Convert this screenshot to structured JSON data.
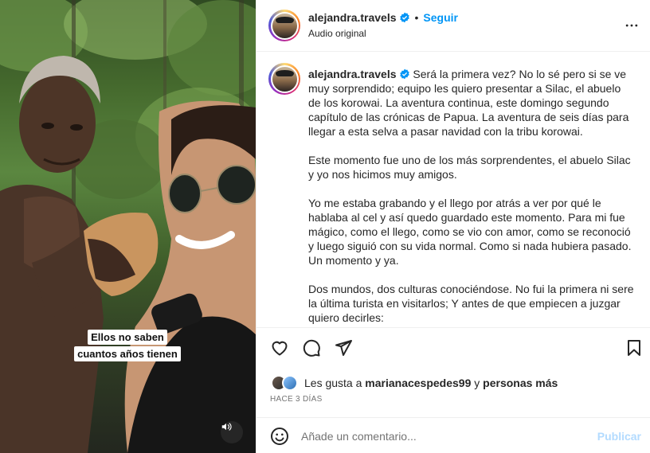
{
  "video": {
    "caption_line1": "Ellos no saben",
    "caption_line2": "cuantos años tienen",
    "mute_icon": "speaker-icon"
  },
  "header": {
    "username": "alejandra.travels",
    "separator": "•",
    "follow_label": "Seguir",
    "audio_label": "Audio original",
    "more_icon": "more-horizontal-icon"
  },
  "post": {
    "username": "alejandra.travels",
    "paragraphs": [
      "Será la primera vez? No lo sé pero si se ve muy sorprendido; equipo les quiero presentar a Silac, el abuelo de los korowai. La aventura continua, este domingo segundo capítulo de las crónicas de Papua. La aventura de seis días para llegar a esta selva a pasar navidad con la tribu korowai.",
      "Este momento fue uno de los más sorprendentes, el abuelo Silac y yo nos hicimos muy amigos.",
      "Yo me estaba grabando y el llego por atrás a ver por qué le hablaba al cel y así quedo guardado este momento. Para mi fue mágico, como el llego, como se vio con amor, como se reconoció y luego siguió con su vida normal. Como si nada hubiera pasado. Un momento y ya.",
      "Dos mundos, dos culturas conociéndose. No fui la primera ni sere la última turista en visitarlos; Y antes de que empiecen a juzgar quiero decirles:"
    ]
  },
  "actions": {
    "like_icon": "heart-icon",
    "comment_icon": "comment-icon",
    "share_icon": "send-icon",
    "save_icon": "bookmark-icon"
  },
  "likes": {
    "prefix": "Les gusta a",
    "user": "marianacespedes99",
    "connector": "y",
    "others": "personas más"
  },
  "time_ago": "HACE 3 DÍAS",
  "comment": {
    "emoji_icon": "emoji-icon",
    "placeholder": "Añade un comentario...",
    "publish_label": "Publicar"
  },
  "colors": {
    "accent": "#0095f6",
    "publish_disabled": "#b3dbff",
    "caption_bg": "#ffffff",
    "muted_text": "#737373"
  }
}
